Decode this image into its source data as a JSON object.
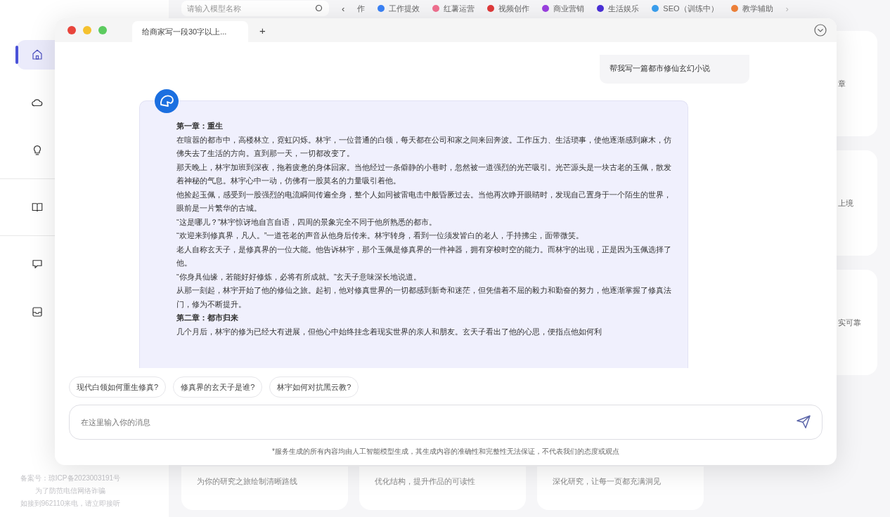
{
  "sidebar": {
    "items": [
      {
        "kind": "home",
        "selected": true
      },
      {
        "kind": "cloud",
        "selected": false
      },
      {
        "kind": "bulb",
        "selected": false
      },
      {
        "kind": "book",
        "selected": false
      },
      {
        "kind": "chat",
        "selected": false
      },
      {
        "kind": "inbox",
        "selected": false
      }
    ],
    "footer": [
      "备案号：琼ICP备2023003191号",
      "为了防范电信网络诈骗",
      "如接到962110来电，请立即接听"
    ]
  },
  "topbar": {
    "search": {
      "placeholder": "请输入模型名称"
    },
    "prev": "‹",
    "next": "›",
    "categories": [
      {
        "label": "作"
      },
      {
        "label": "工作提效",
        "color": "#3b82f6"
      },
      {
        "label": "红薯运营",
        "color": "#f0708f"
      },
      {
        "label": "视频创作",
        "color": "#e03a3a"
      },
      {
        "label": "商业营销",
        "color": "#9b40e0"
      },
      {
        "label": "生活娱乐",
        "color": "#4a30d8"
      },
      {
        "label": "SEO（训练中）",
        "color": "#3ba0ef"
      },
      {
        "label": "教学辅助",
        "color": "#f0823a"
      }
    ]
  },
  "side_cards": [
    "章",
    "上境",
    "实可靠"
  ],
  "bottom_cards": [
    "为你的研究之旅绘制清晰路线",
    "优化结构，提升作品的可读性",
    "深化研究，让每一页都充满洞见"
  ],
  "chat": {
    "tabs": [
      {
        "label": "给商家写一段30字以上...",
        "selected": true
      }
    ],
    "new_tab": "+",
    "user_message": "帮我写一篇都市修仙玄幻小说",
    "reply": [
      {
        "kind": "heading",
        "text": "第一章：重生"
      },
      {
        "kind": "text",
        "text": "在喧嚣的都市中，高楼林立，霓虹闪烁。林宇，一位普通的白领，每天都在公司和家之间来回奔波。工作压力、生活琐事，使他逐渐感到麻木，仿佛失去了生活的方向。直到那一天，一切都改变了。"
      },
      {
        "kind": "text",
        "text": "那天晚上，林宇加班到深夜，拖着疲惫的身体回家。当他经过一条僻静的小巷时，忽然被一道强烈的光芒吸引。光芒源头是一块古老的玉佩，散发着神秘的气息。林宇心中一动，仿佛有一股莫名的力量吸引着他。"
      },
      {
        "kind": "text",
        "text": "他捡起玉佩，感受到一股强烈的电流瞬间传遍全身，整个人如同被雷电击中般昏厥过去。当他再次睁开眼睛时，发现自己置身于一个陌生的世界，眼前是一片繁华的古城。"
      },
      {
        "kind": "text",
        "text": "“这是哪儿？”林宇惊讶地自言自语，四周的景象完全不同于他所熟悉的都市。"
      },
      {
        "kind": "text",
        "text": "“欢迎来到修真界，凡人。”一道苍老的声音从他身后传来。林宇转身，看到一位须发皆白的老人，手持拂尘，面带微笑。"
      },
      {
        "kind": "text",
        "text": "老人自称玄天子，是修真界的一位大能。他告诉林宇，那个玉佩是修真界的一件神器，拥有穿梭时空的能力。而林宇的出现，正是因为玉佩选择了他。"
      },
      {
        "kind": "text",
        "text": "“你身具仙缘，若能好好修炼，必将有所成就。”玄天子意味深长地说道。"
      },
      {
        "kind": "text",
        "text": "从那一刻起，林宇开始了他的修仙之旅。起初，他对修真世界的一切都感到新奇和迷茫，但凭借着不屈的毅力和勤奋的努力，他逐渐掌握了修真法门，修为不断提升。"
      },
      {
        "kind": "heading",
        "text": "第二章：都市归来"
      },
      {
        "kind": "text",
        "text": "几个月后，林宇的修为已经大有进展，但他心中始终挂念着现实世界的亲人和朋友。玄天子看出了他的心思，便指点他如何利"
      }
    ],
    "suggestions": [
      "现代白领如何重生修真?",
      "修真界的玄天子是谁?",
      "林宇如何对抗黑云教?"
    ],
    "input": {
      "placeholder": "在这里输入你的消息"
    },
    "disclaimer": "*服务生成的所有内容均由人工智能模型生成，其生成内容的准确性和完整性无法保证，不代表我们的态度或观点"
  }
}
